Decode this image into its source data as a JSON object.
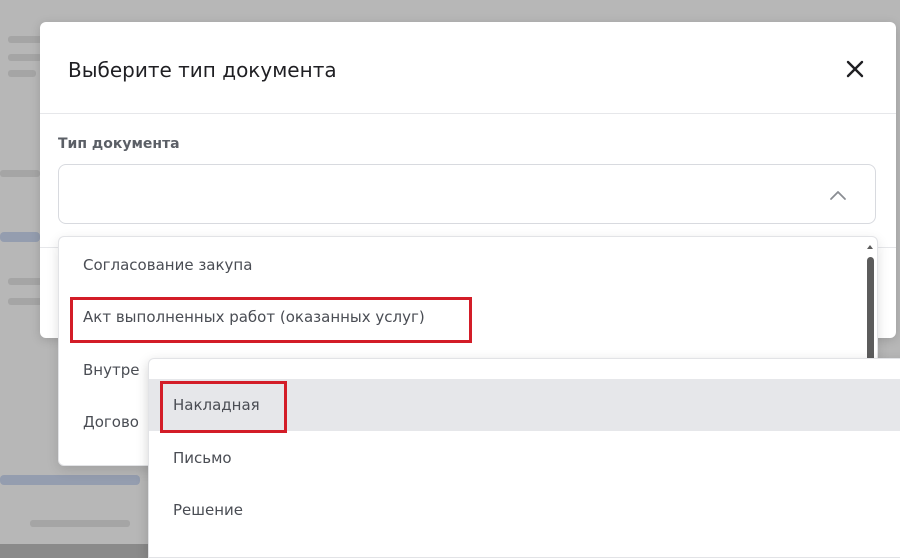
{
  "modal": {
    "title": "Выберите тип документа",
    "close_icon": "close-icon",
    "field_label": "Тип документа",
    "select_value": "",
    "chevron_icon": "chevron-up-icon"
  },
  "dropdown": {
    "items": [
      {
        "label": "Согласование закупа"
      },
      {
        "label": "Акт выполненных работ (оказанных услуг)"
      },
      {
        "label": "Внутре"
      },
      {
        "label": "Догово"
      }
    ]
  },
  "submenu": {
    "items": [
      {
        "label": "Накладная",
        "active": true
      },
      {
        "label": "Письмо",
        "active": false
      },
      {
        "label": "Решение",
        "active": false
      }
    ]
  },
  "colors": {
    "highlight": "#d31d28",
    "active_item_bg": "#e6e7ea",
    "overlay": "#8a8a8a"
  }
}
